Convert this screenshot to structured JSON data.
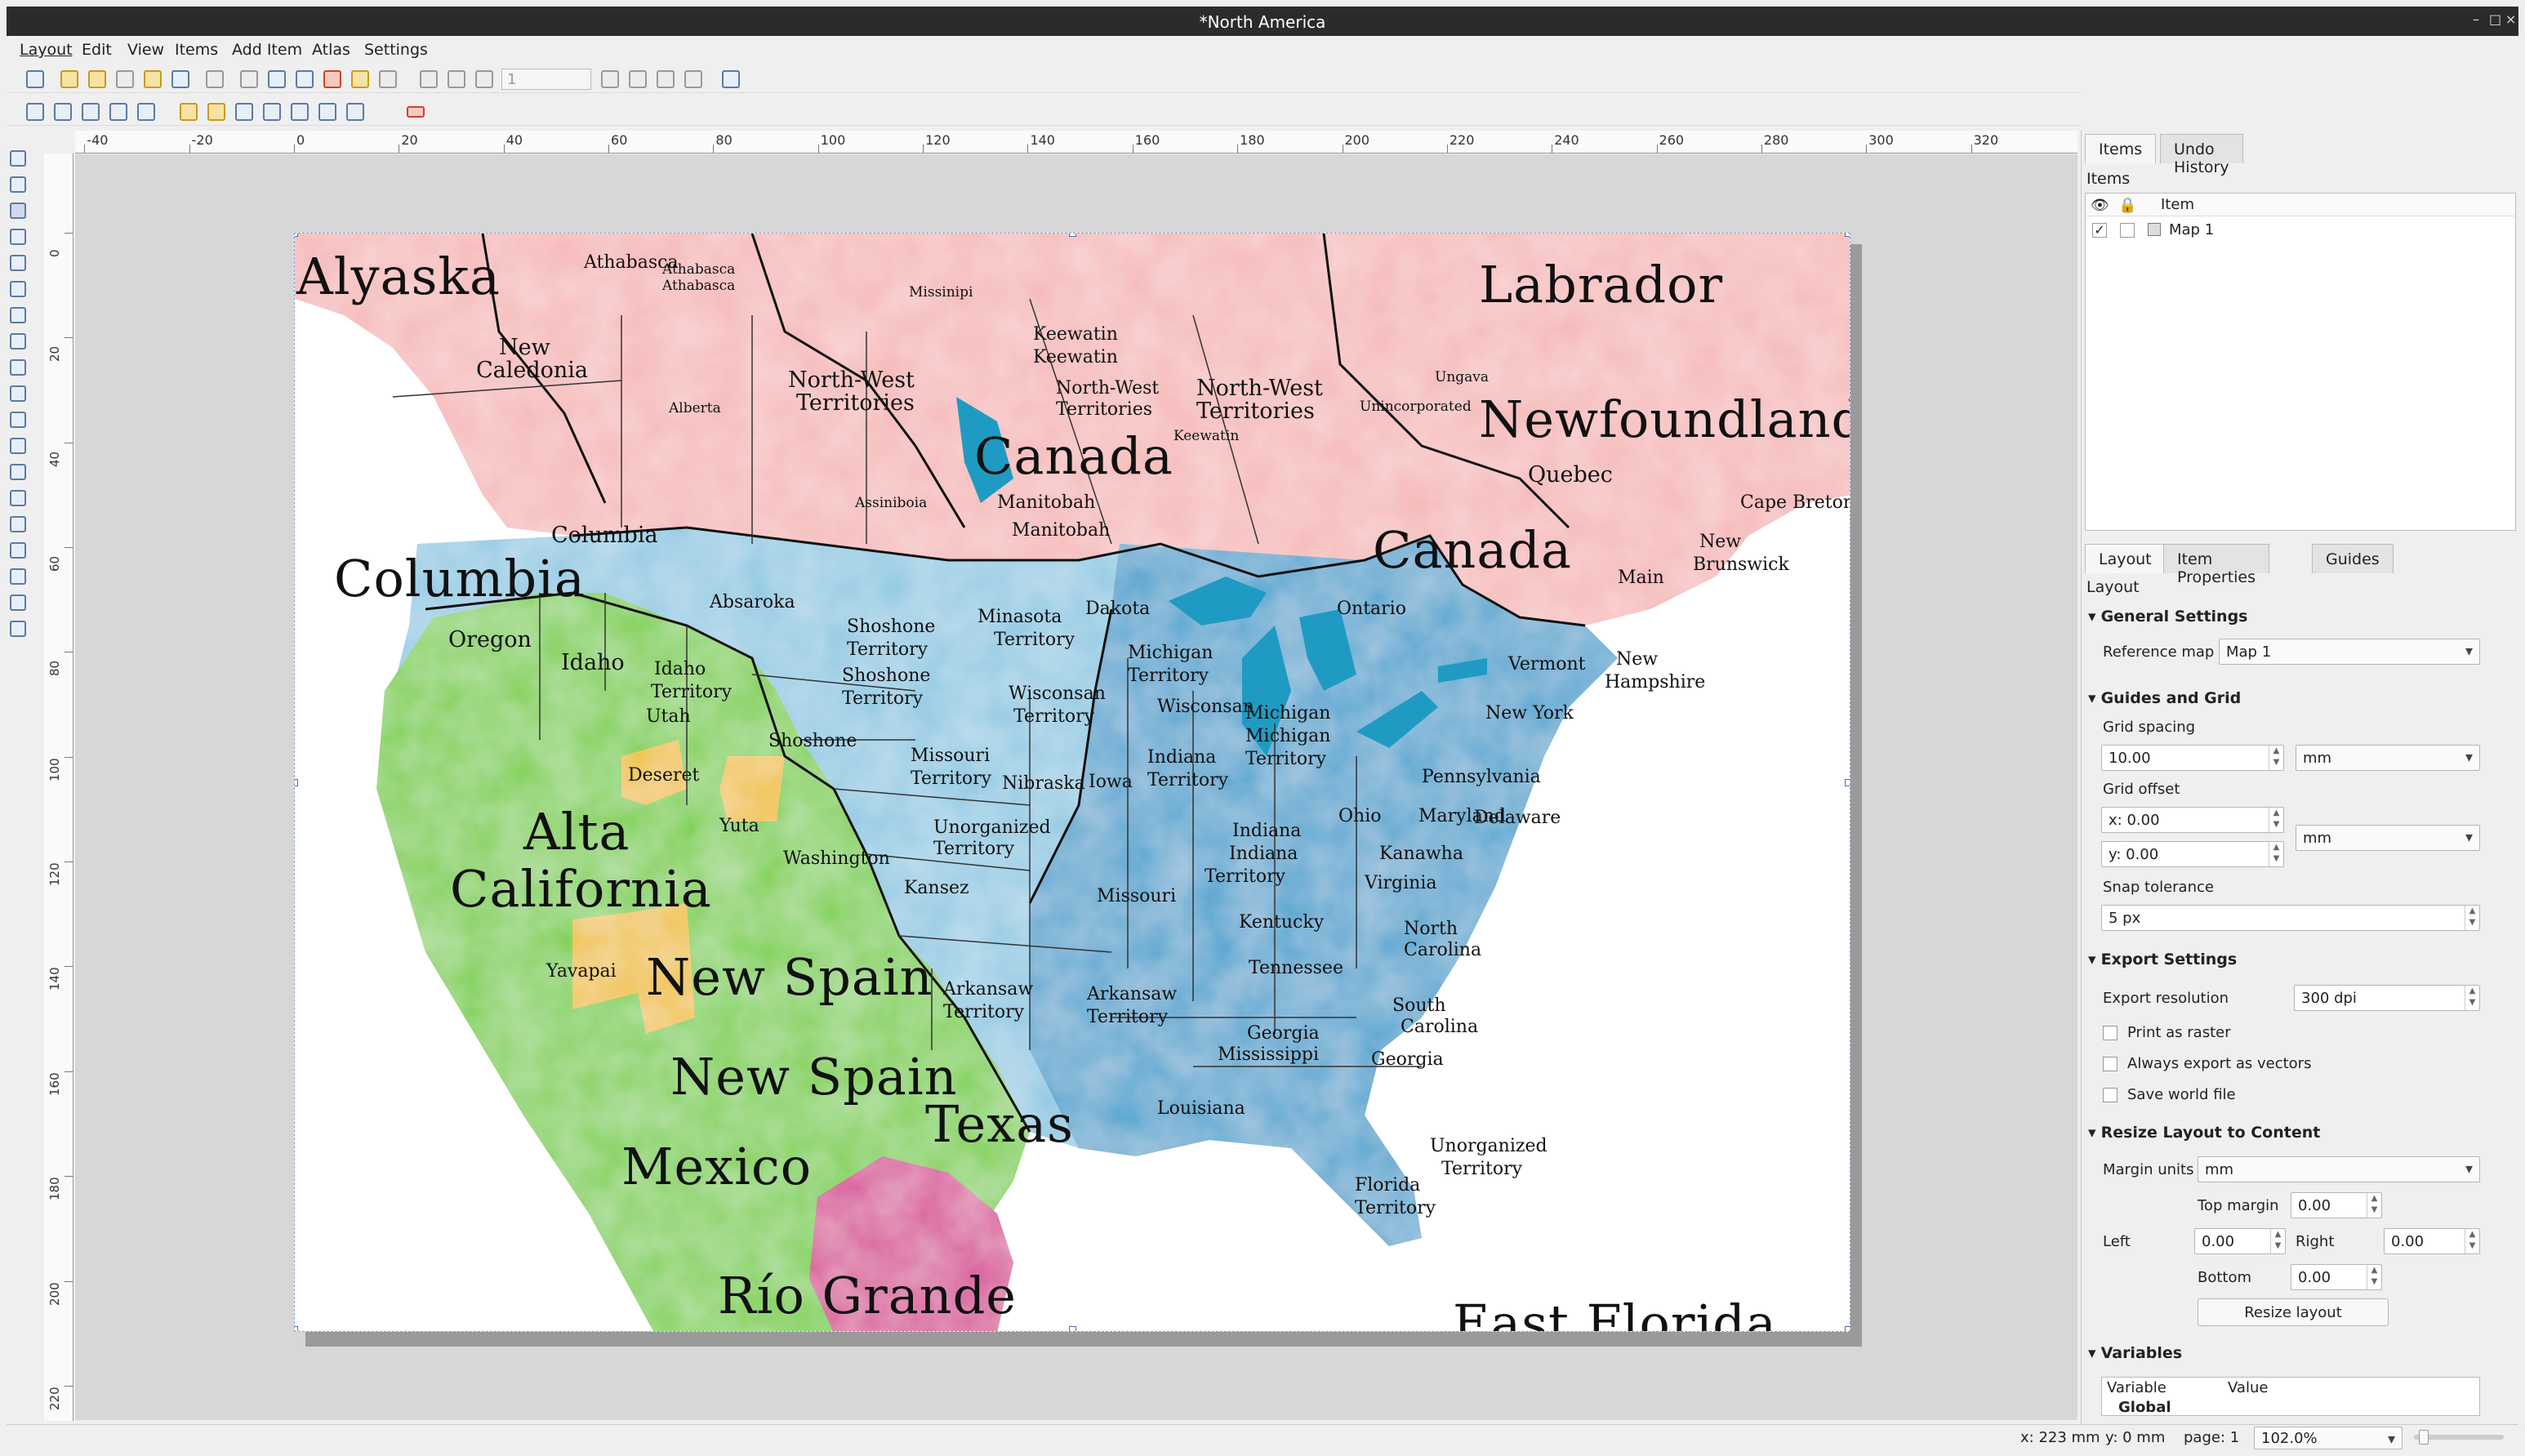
{
  "window": {
    "title": "*North America",
    "controls": {
      "minimize": "–",
      "maximize": "□",
      "close": "×"
    }
  },
  "menu": [
    "Layout",
    "Edit",
    "View",
    "Items",
    "Add Item",
    "Atlas",
    "Settings"
  ],
  "toolbar": {
    "page_field": "1"
  },
  "ruler_h": [
    "-40",
    "-20",
    "0",
    "20",
    "40",
    "60",
    "80",
    "100",
    "120",
    "140",
    "160",
    "180",
    "200",
    "220",
    "240",
    "260",
    "280",
    "300",
    "320"
  ],
  "ruler_v": [
    "0",
    "20",
    "40",
    "60",
    "80",
    "100",
    "120",
    "140",
    "160",
    "180",
    "200",
    "220"
  ],
  "map": {
    "colors": {
      "canada": "#f6b8b8",
      "usa": "#8fc9e3",
      "usa_dark": "#4aa3cf",
      "spain": "#7cd04a",
      "mexico": "#6ecb3c",
      "rio": "#d84c97",
      "yellow": "#f0c23a",
      "water": "#1f9bc3"
    },
    "labels": [
      {
        "t": "Alyaska",
        "s": "big"
      },
      {
        "t": "Labrador",
        "s": "big"
      },
      {
        "t": "Newfoundland",
        "s": "big"
      },
      {
        "t": "Canada",
        "s": "big"
      },
      {
        "t": "Canada",
        "s": "big"
      },
      {
        "t": "Columbia",
        "s": "big"
      },
      {
        "t": "Alta",
        "s": "big"
      },
      {
        "t": "California",
        "s": "big"
      },
      {
        "t": "New Spain",
        "s": "big"
      },
      {
        "t": "New Spain",
        "s": "big"
      },
      {
        "t": "Texas",
        "s": "big"
      },
      {
        "t": "Mexico",
        "s": "big"
      },
      {
        "t": "Río Grande",
        "s": "big"
      },
      {
        "t": "East Florida",
        "s": "big"
      },
      {
        "t": "Athabasca",
        "s": "sm"
      },
      {
        "t": "Athabasca",
        "s": "xs"
      },
      {
        "t": "Athabasca",
        "s": "xs"
      },
      {
        "t": "New",
        "s": "med"
      },
      {
        "t": "Caledonia",
        "s": "med"
      },
      {
        "t": "Alberta",
        "s": "xs"
      },
      {
        "t": "Columbia",
        "s": "med"
      },
      {
        "t": "Missinipi",
        "s": "xs"
      },
      {
        "t": "Keewatin",
        "s": "sm"
      },
      {
        "t": "Keewatin",
        "s": "sm"
      },
      {
        "t": "North-West",
        "s": "med"
      },
      {
        "t": "Territories",
        "s": "med"
      },
      {
        "t": "North-West",
        "s": "sm"
      },
      {
        "t": "Territories",
        "s": "sm"
      },
      {
        "t": "North-West",
        "s": "med"
      },
      {
        "t": "Territories",
        "s": "med"
      },
      {
        "t": "Keewatin",
        "s": "xs"
      },
      {
        "t": "Ungava",
        "s": "xs"
      },
      {
        "t": "Unincorporated",
        "s": "xs"
      },
      {
        "t": "Assiniboia",
        "s": "xs"
      },
      {
        "t": "Manitobah",
        "s": "sm"
      },
      {
        "t": "Manitobah",
        "s": "sm"
      },
      {
        "t": "Quebec",
        "s": "med"
      },
      {
        "t": "Cape Breton",
        "s": "sm"
      },
      {
        "t": "New",
        "s": "sm"
      },
      {
        "t": "Brunswick",
        "s": "sm"
      },
      {
        "t": "Ontario",
        "s": "sm"
      },
      {
        "t": "Main",
        "s": "sm"
      },
      {
        "t": "Oregon",
        "s": "med"
      },
      {
        "t": "Idaho",
        "s": "med"
      },
      {
        "t": "Idaho",
        "s": "sm"
      },
      {
        "t": "Territory",
        "s": "sm"
      },
      {
        "t": "Utah",
        "s": "sm"
      },
      {
        "t": "Absaroka",
        "s": "sm"
      },
      {
        "t": "Shoshone",
        "s": "sm"
      },
      {
        "t": "Territory",
        "s": "sm"
      },
      {
        "t": "Shoshone",
        "s": "sm"
      },
      {
        "t": "Territory",
        "s": "sm"
      },
      {
        "t": "Shoshone",
        "s": "sm"
      },
      {
        "t": "Minasota",
        "s": "sm"
      },
      {
        "t": "Territory",
        "s": "sm"
      },
      {
        "t": "Dakota",
        "s": "sm"
      },
      {
        "t": "Michigan",
        "s": "sm"
      },
      {
        "t": "Territory",
        "s": "sm"
      },
      {
        "t": "Wisconsan",
        "s": "sm"
      },
      {
        "t": "Territory",
        "s": "sm"
      },
      {
        "t": "Wisconsan",
        "s": "sm"
      },
      {
        "t": "Michigan",
        "s": "sm"
      },
      {
        "t": "Michigan",
        "s": "sm"
      },
      {
        "t": "Territory",
        "s": "sm"
      },
      {
        "t": "Vermont",
        "s": "sm"
      },
      {
        "t": "New",
        "s": "sm"
      },
      {
        "t": "Hampshire",
        "s": "sm"
      },
      {
        "t": "New York",
        "s": "sm"
      },
      {
        "t": "Missouri",
        "s": "sm"
      },
      {
        "t": "Territory",
        "s": "sm"
      },
      {
        "t": "Nibraska",
        "s": "sm"
      },
      {
        "t": "Iowa",
        "s": "sm"
      },
      {
        "t": "Indiana",
        "s": "sm"
      },
      {
        "t": "Territory",
        "s": "sm"
      },
      {
        "t": "Pennsylvania",
        "s": "sm"
      },
      {
        "t": "Deseret",
        "s": "sm"
      },
      {
        "t": "Yuta",
        "s": "sm"
      },
      {
        "t": "Unorganized",
        "s": "sm"
      },
      {
        "t": "Territory",
        "s": "sm"
      },
      {
        "t": "Washington",
        "s": "sm"
      },
      {
        "t": "Kansez",
        "s": "sm"
      },
      {
        "t": "Missouri",
        "s": "sm"
      },
      {
        "t": "Indiana",
        "s": "sm"
      },
      {
        "t": "Indiana",
        "s": "sm"
      },
      {
        "t": "Territory",
        "s": "sm"
      },
      {
        "t": "Ohio",
        "s": "sm"
      },
      {
        "t": "Maryland",
        "s": "sm"
      },
      {
        "t": "Delaware",
        "s": "sm"
      },
      {
        "t": "Kanawha",
        "s": "sm"
      },
      {
        "t": "Virginia",
        "s": "sm"
      },
      {
        "t": "Kentucky",
        "s": "sm"
      },
      {
        "t": "North",
        "s": "sm"
      },
      {
        "t": "Carolina",
        "s": "sm"
      },
      {
        "t": "Yavapai",
        "s": "sm"
      },
      {
        "t": "Arkansaw",
        "s": "sm"
      },
      {
        "t": "Territory",
        "s": "sm"
      },
      {
        "t": "Arkansaw",
        "s": "sm"
      },
      {
        "t": "Territory",
        "s": "sm"
      },
      {
        "t": "Tennessee",
        "s": "sm"
      },
      {
        "t": "South",
        "s": "sm"
      },
      {
        "t": "Carolina",
        "s": "sm"
      },
      {
        "t": "Georgia",
        "s": "sm"
      },
      {
        "t": "Mississippi",
        "s": "sm"
      },
      {
        "t": "Georgia",
        "s": "sm"
      },
      {
        "t": "Louisiana",
        "s": "sm"
      },
      {
        "t": "Unorganized",
        "s": "sm"
      },
      {
        "t": "Territory",
        "s": "sm"
      },
      {
        "t": "Florida",
        "s": "sm"
      },
      {
        "t": "Territory",
        "s": "sm"
      }
    ]
  },
  "panel": {
    "top_tabs": [
      "Items",
      "Undo History"
    ],
    "items_label": "Items",
    "items_header": "Item",
    "items": [
      {
        "name": "Map 1",
        "visible": "✓"
      }
    ],
    "bottom_tabs": [
      "Layout",
      "Item Properties",
      "Guides"
    ],
    "layout_label": "Layout",
    "general": {
      "title": "General Settings",
      "ref_label": "Reference map",
      "ref_value": "Map 1"
    },
    "guides": {
      "title": "Guides and Grid",
      "spacing_label": "Grid spacing",
      "spacing": "10.00",
      "unit": "mm",
      "offset_label": "Grid offset",
      "x": "x: 0.00",
      "y": "y: 0.00",
      "offset_unit": "mm",
      "snap_label": "Snap tolerance",
      "snap": "5 px"
    },
    "export": {
      "title": "Export Settings",
      "res_label": "Export resolution",
      "res": "300 dpi",
      "raster": "Print as raster",
      "vectors": "Always export as vectors",
      "world": "Save world file"
    },
    "resize": {
      "title": "Resize Layout to Content",
      "margin_label": "Margin units",
      "margin_unit": "mm",
      "top_label": "Top margin",
      "top": "0.00",
      "left_label": "Left",
      "left": "0.00",
      "right_label": "Right",
      "right": "0.00",
      "bottom_label": "Bottom",
      "bottom": "0.00",
      "button": "Resize layout"
    },
    "variables": {
      "title": "Variables",
      "col1": "Variable",
      "col2": "Value",
      "row": "Global"
    }
  },
  "status": {
    "x": "x: 223 mm",
    "y": "y: 0 mm",
    "page": "page: 1",
    "zoom": "102.0%"
  }
}
